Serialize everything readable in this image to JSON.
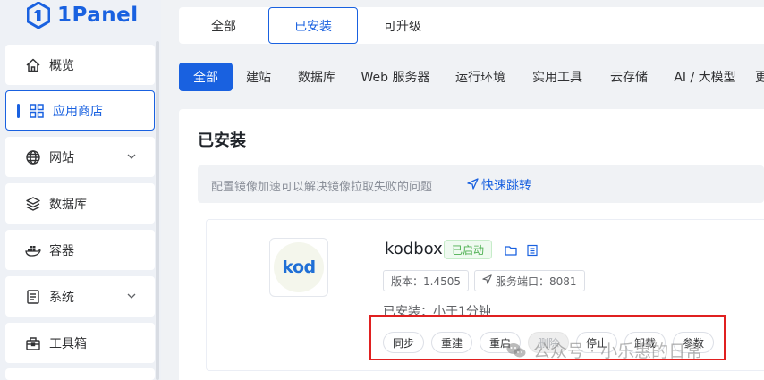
{
  "logo": {
    "text": "1Panel"
  },
  "sidebar": {
    "items": [
      {
        "label": "概览",
        "icon": "home-icon"
      },
      {
        "label": "应用商店",
        "icon": "grid-icon"
      },
      {
        "label": "网站",
        "icon": "globe-icon"
      },
      {
        "label": "数据库",
        "icon": "layers-icon"
      },
      {
        "label": "容器",
        "icon": "docker-icon"
      },
      {
        "label": "系统",
        "icon": "document-icon"
      },
      {
        "label": "工具箱",
        "icon": "toolbox-icon"
      }
    ]
  },
  "top_tabs": [
    "全部",
    "已安装",
    "可升级"
  ],
  "categories": [
    "全部",
    "建站",
    "数据库",
    "Web 服务器",
    "运行环境",
    "实用工具",
    "云存储",
    "AI / 大模型",
    "更"
  ],
  "section": {
    "title": "已安装",
    "notice": "配置镜像加速可以解决镜像拉取失败的问题",
    "notice_link": "快速跳转"
  },
  "app": {
    "icon_text": "kod",
    "name": "kodbox",
    "status": "已启动",
    "version": "版本：1.4505",
    "port": "服务端口：8081",
    "installed": "已安装：小于1分钟",
    "actions": [
      "同步",
      "重建",
      "重启",
      "删除",
      "停止",
      "卸载",
      "参数"
    ]
  },
  "watermark": {
    "text": "公众号 · 小乐惠的日常"
  },
  "colors": {
    "primary": "#1961e0",
    "success": "#4caf50",
    "highlight": "#e02020"
  }
}
